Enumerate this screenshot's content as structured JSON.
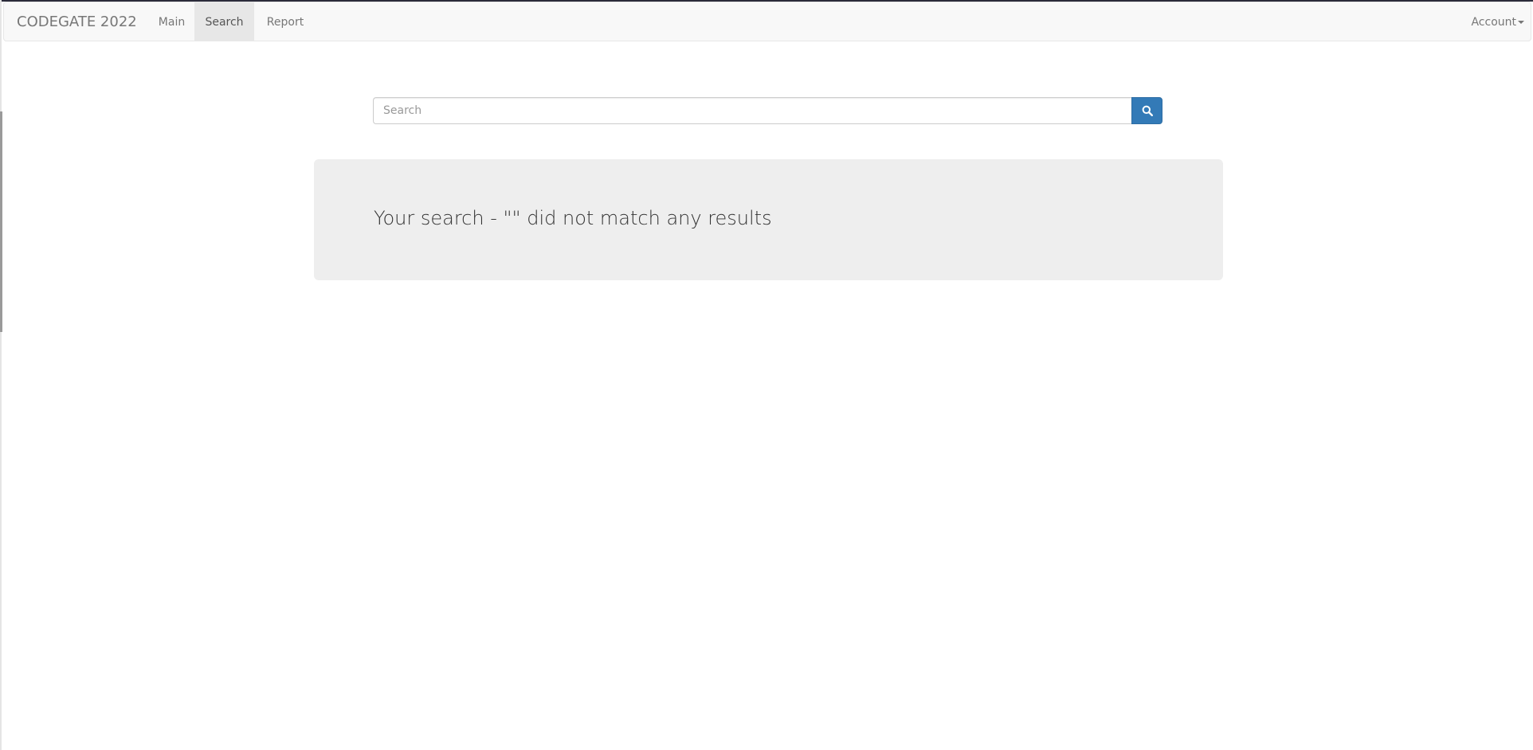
{
  "navbar": {
    "brand": "CODEGATE 2022",
    "items": [
      {
        "label": "Main"
      },
      {
        "label": "Search"
      },
      {
        "label": "Report"
      }
    ],
    "active_item": "Search",
    "account_label": "Account"
  },
  "search": {
    "placeholder": "Search",
    "value": "",
    "button_icon": "search-icon"
  },
  "result": {
    "message": "Your search - \"\" did not match any results"
  },
  "colors": {
    "primary_button": "#337ab7",
    "navbar_bg": "#f8f8f8",
    "jumbotron_bg": "#eeeeee"
  }
}
